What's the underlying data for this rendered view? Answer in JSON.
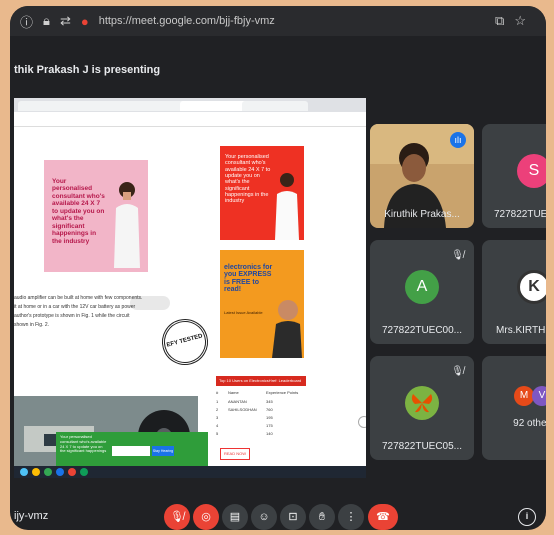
{
  "browser": {
    "url": "https://meet.google.com/bjj-fbjy-vmz"
  },
  "presenting_label": "thik Prakash J is presenting",
  "shared_screen": {
    "ad_pink_text": "Your personalised consultant who's available 24 X 7 to update you on what's the significant happenings in the industry",
    "ad_red_text": "Your personalised consultant who's available 24 X 7 to update you on what's the significant happenings in the industry",
    "ad_orange_title": "electronics for you EXPRESS is FREE to read!",
    "ad_orange_sub": "Latest Issue Available",
    "article_lines": [
      "audio amplifier can be built at home with few components.",
      "it at home or in a car with the 12V car battery as power",
      "author's prototype is shown in Fig. 1 while the circuit",
      "shown in Fig. 2."
    ],
    "stamp": "EFY TESTED",
    "table_title": "Top 10 Users on ElectronicsHref: Leaderboard",
    "table_headers": [
      "#",
      "Name",
      "Experience Points"
    ],
    "table_rows": [
      [
        "1",
        "ANANTAN",
        "345"
      ],
      [
        "2",
        "SAHILSODHAN",
        "760"
      ],
      [
        "3",
        "",
        "195"
      ],
      [
        "4",
        "",
        "175"
      ],
      [
        "5",
        "",
        "140"
      ]
    ],
    "bottom_ad_text": "Your personalised consultant who's available 24 X 7 to update you on the significant happenings",
    "bottom_ad_button": "Stay Hearing",
    "read_now": "READ NOW"
  },
  "participants": [
    {
      "name": "Kiruthik Prakas...",
      "type": "video",
      "mic": "on"
    },
    {
      "name": "727822TUEC23...",
      "initial": "S",
      "color": "#ec407a",
      "mic": "off"
    },
    {
      "name": "727822TUEC00...",
      "initial": "A",
      "color": "#43a047",
      "mic": "off"
    },
    {
      "name": "Mrs.KIRTHIKA ...",
      "initial": "K",
      "color": "#ffffff",
      "mic": "off"
    },
    {
      "name": "727822TUEC05...",
      "initial": "",
      "color": "#7cb342",
      "mic": "off"
    },
    {
      "name": "92 others",
      "initial": "M",
      "initial2": "V",
      "color": "#e64a19",
      "color2": "#7e57c2"
    }
  ],
  "meeting_code": "ijy-vmz",
  "controls": [
    "mic-off",
    "camera-off",
    "captions",
    "emoji",
    "present",
    "raise-hand",
    "more",
    "leave"
  ],
  "colors": {
    "leave": "#ea4335",
    "muted": "#ea4335",
    "tile": "#3c4043",
    "background": "#202124"
  }
}
